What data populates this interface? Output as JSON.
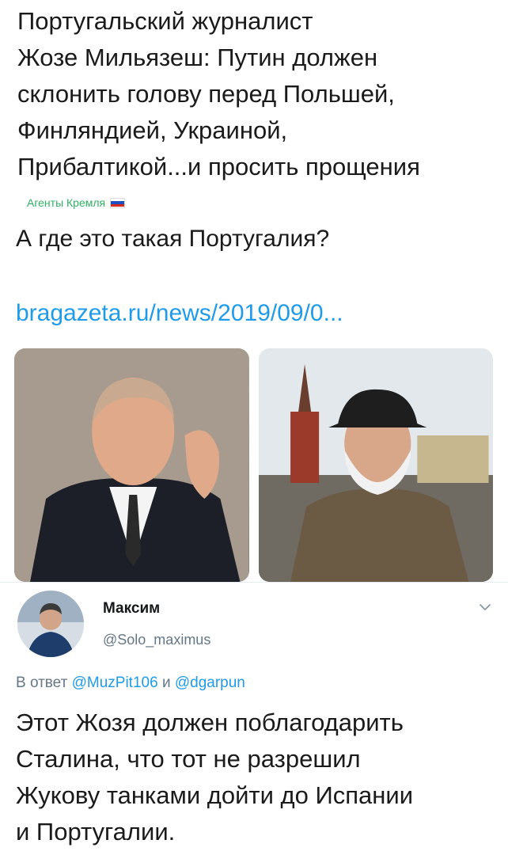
{
  "article": {
    "headline": "Португальский журналист\nЖозе Мильязеш: Путин должен\nсклонить голову перед Польшей,\nФинляндией, Украиной,\nПрибалтикой...и просить прощения",
    "source": "Агенты Кремля",
    "source_flag_colors": [
      "#ffffff",
      "#1f4fbf",
      "#d52b1e"
    ],
    "question": "А где это такая Португалия?",
    "link": "bragazeta.ru/news/2019/09/0..."
  },
  "media": {
    "left_icon": "man-in-suit-photo",
    "right_icon": "bearded-man-kremlin-photo"
  },
  "reply": {
    "name": "Максим",
    "handle": "@Solo_maximus",
    "reply_prefix": "В ответ",
    "reply_user1": "@MuzPit106",
    "reply_and": "и",
    "reply_user2": "@dgarpun",
    "text": "Этот Жозя должен поблагодарить\nСталина, что тот не разрешил\nЖукову танками дойти до Испании\nи Португалии."
  },
  "colors": {
    "link": "#1f9bea",
    "source": "#2fb166",
    "muted": "#657786"
  }
}
